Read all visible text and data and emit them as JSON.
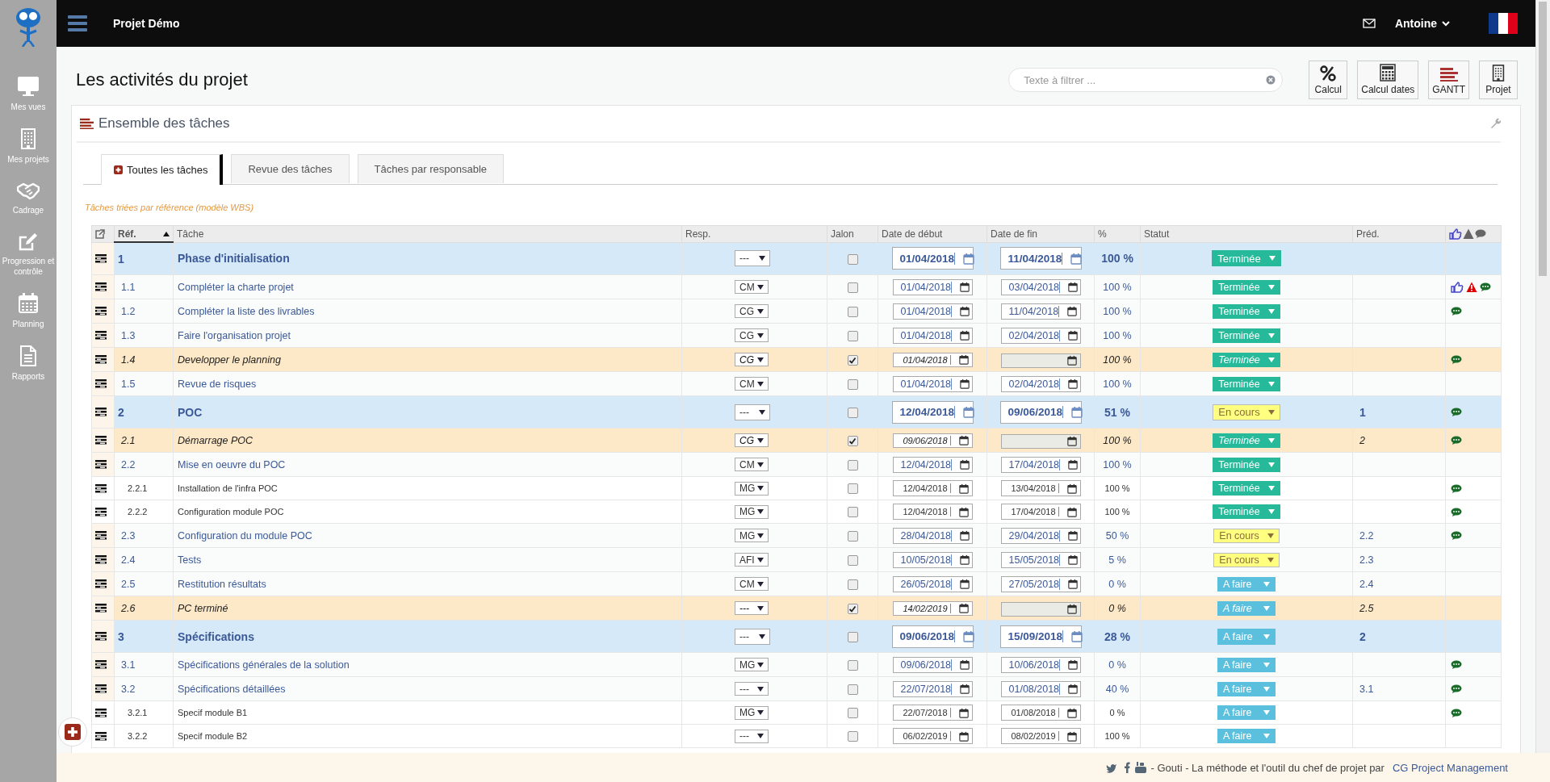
{
  "sidebar": {
    "items": [
      {
        "label": "Mes vues"
      },
      {
        "label": "Mes projets"
      },
      {
        "label": "Cadrage"
      },
      {
        "label": "Progression et contrôle"
      },
      {
        "label": "Planning"
      },
      {
        "label": "Rapports"
      }
    ]
  },
  "topbar": {
    "project": "Projet Démo",
    "user": "Antoine"
  },
  "page": {
    "title": "Les activités du projet",
    "search": {
      "placeholder": "Texte à filtrer ..."
    },
    "buttons": [
      {
        "label": "Calcul"
      },
      {
        "label": "Calcul dates"
      },
      {
        "label": "GANTT"
      },
      {
        "label": "Projet"
      }
    ]
  },
  "panel": {
    "title": "Ensemble des tâches",
    "tabs": [
      {
        "label": "Toutes les tâches",
        "selected": true
      },
      {
        "label": "Revue des tâches",
        "selected": false
      },
      {
        "label": "Tâches par responsable",
        "selected": false
      }
    ],
    "caption": "Tâches triées par référence (modèle WBS)",
    "table": {
      "columns": [
        {
          "label": "Réf.",
          "sorted": true
        },
        {
          "label": "Tâche",
          "sorted": false
        },
        {
          "label": "Resp.",
          "sorted": false
        },
        {
          "label": "Jalon",
          "sorted": false
        },
        {
          "label": "Date de début",
          "sorted": false
        },
        {
          "label": "Date de fin",
          "sorted": false
        },
        {
          "label": "%",
          "sorted": false
        },
        {
          "label": "Statut",
          "sorted": false
        },
        {
          "label": "Préd.",
          "sorted": false
        }
      ],
      "rows": [
        {
          "kind": "phase",
          "ref": "1",
          "task": "Phase d'initialisation",
          "resp": "---",
          "milestone": false,
          "start": "01/04/2018",
          "end": "11/04/2018",
          "pct": "100 %",
          "status": {
            "label": "Terminée",
            "kind": "done"
          },
          "liked": false,
          "alert": false,
          "commented": false
        },
        {
          "kind": "task",
          "ref": "1.1",
          "task": "Compléter la charte projet",
          "resp": "CM",
          "milestone": false,
          "start": "01/04/2018",
          "end": "03/04/2018",
          "pct": "100 %",
          "status": {
            "label": "Terminée",
            "kind": "done"
          },
          "liked": true,
          "alert": true,
          "commented": true
        },
        {
          "kind": "task",
          "ref": "1.2",
          "task": "Compléter la liste des livrables",
          "resp": "CG",
          "milestone": false,
          "start": "01/04/2018",
          "end": "11/04/2018",
          "pct": "100 %",
          "status": {
            "label": "Terminée",
            "kind": "done"
          },
          "liked": false,
          "alert": false,
          "commented": true
        },
        {
          "kind": "task",
          "ref": "1.3",
          "task": "Faire l'organisation projet",
          "resp": "CG",
          "milestone": false,
          "start": "01/04/2018",
          "end": "02/04/2018",
          "pct": "100 %",
          "status": {
            "label": "Terminée",
            "kind": "done"
          },
          "liked": false,
          "alert": false,
          "commented": false
        },
        {
          "kind": "milestone",
          "ref": "1.4",
          "task": "Developper le planning",
          "resp": "CG",
          "milestone": true,
          "start": "01/04/2018",
          "pct": "100 %",
          "status": {
            "label": "Terminée",
            "kind": "done"
          },
          "liked": false,
          "alert": false,
          "commented": true
        },
        {
          "kind": "task",
          "ref": "1.5",
          "task": "Revue de risques",
          "resp": "CM",
          "milestone": false,
          "start": "01/04/2018",
          "end": "02/04/2018",
          "pct": "100 %",
          "status": {
            "label": "Terminée",
            "kind": "done"
          },
          "liked": false,
          "alert": false,
          "commented": false
        },
        {
          "kind": "phase",
          "ref": "2",
          "task": "POC",
          "resp": "---",
          "milestone": false,
          "start": "12/04/2018",
          "end": "09/06/2018",
          "pct": "51 %",
          "status": {
            "label": "En cours",
            "kind": "progress"
          },
          "pred": "1",
          "liked": false,
          "alert": false,
          "commented": true
        },
        {
          "kind": "milestone",
          "ref": "2.1",
          "task": "Démarrage POC",
          "resp": "CG",
          "milestone": true,
          "start": "09/06/2018",
          "pct": "100 %",
          "status": {
            "label": "Terminée",
            "kind": "done"
          },
          "pred": "2",
          "liked": false,
          "alert": false,
          "commented": true
        },
        {
          "kind": "task",
          "ref": "2.2",
          "task": "Mise en oeuvre du POC",
          "resp": "CM",
          "milestone": false,
          "start": "12/04/2018",
          "end": "17/04/2018",
          "pct": "100 %",
          "status": {
            "label": "Terminée",
            "kind": "done"
          },
          "liked": false,
          "alert": false,
          "commented": false
        },
        {
          "kind": "subtask",
          "ref": "2.2.1",
          "task": "Installation de l'infra POC",
          "resp": "MG",
          "milestone": false,
          "start": "12/04/2018",
          "end": "13/04/2018",
          "pct": "100 %",
          "status": {
            "label": "Terminée",
            "kind": "done"
          },
          "liked": false,
          "alert": false,
          "commented": true
        },
        {
          "kind": "subtask",
          "ref": "2.2.2",
          "task": "Configuration module POC",
          "resp": "MG",
          "milestone": false,
          "start": "12/04/2018",
          "end": "17/04/2018",
          "pct": "100 %",
          "status": {
            "label": "Terminée",
            "kind": "done"
          },
          "liked": false,
          "alert": false,
          "commented": true
        },
        {
          "kind": "task",
          "ref": "2.3",
          "task": "Configuration du module POC",
          "resp": "MG",
          "milestone": false,
          "start": "28/04/2018",
          "end": "29/04/2018",
          "pct": "50 %",
          "status": {
            "label": "En cours",
            "kind": "progress"
          },
          "pred": "2.2",
          "liked": false,
          "alert": false,
          "commented": true
        },
        {
          "kind": "task",
          "ref": "2.4",
          "task": "Tests",
          "resp": "AFI",
          "milestone": false,
          "start": "10/05/2018",
          "end": "15/05/2018",
          "pct": "5 %",
          "status": {
            "label": "En cours",
            "kind": "progress"
          },
          "pred": "2.3",
          "liked": false,
          "alert": false,
          "commented": false
        },
        {
          "kind": "task",
          "ref": "2.5",
          "task": "Restitution résultats",
          "resp": "CM",
          "milestone": false,
          "start": "26/05/2018",
          "end": "27/05/2018",
          "pct": "0 %",
          "status": {
            "label": "A faire",
            "kind": "todo"
          },
          "pred": "2.4",
          "liked": false,
          "alert": false,
          "commented": false
        },
        {
          "kind": "milestone",
          "ref": "2.6",
          "task": "PC terminé",
          "resp": "---",
          "milestone": true,
          "start": "14/02/2019",
          "pct": "0 %",
          "status": {
            "label": "A faire",
            "kind": "todo"
          },
          "pred": "2.5",
          "liked": false,
          "alert": false,
          "commented": false
        },
        {
          "kind": "phase",
          "ref": "3",
          "task": "Spécifications",
          "resp": "---",
          "milestone": false,
          "start": "09/06/2018",
          "end": "15/09/2018",
          "pct": "28 %",
          "status": {
            "label": "A faire",
            "kind": "todo"
          },
          "pred": "2",
          "liked": false,
          "alert": false,
          "commented": false
        },
        {
          "kind": "task",
          "ref": "3.1",
          "task": "Spécifications générales de la solution",
          "resp": "MG",
          "milestone": false,
          "start": "09/06/2018",
          "end": "10/06/2018",
          "pct": "0 %",
          "status": {
            "label": "A faire",
            "kind": "todo"
          },
          "liked": false,
          "alert": false,
          "commented": true
        },
        {
          "kind": "task",
          "ref": "3.2",
          "task": "Spécifications détaillées",
          "resp": "---",
          "milestone": false,
          "start": "22/07/2018",
          "end": "01/08/2018",
          "pct": "40 %",
          "status": {
            "label": "A faire",
            "kind": "todo"
          },
          "pred": "3.1",
          "liked": false,
          "alert": false,
          "commented": true
        },
        {
          "kind": "subtask",
          "ref": "3.2.1",
          "task": "Specif module B1",
          "resp": "MG",
          "milestone": false,
          "start": "22/07/2018",
          "end": "01/08/2018",
          "pct": "0 %",
          "status": {
            "label": "A faire",
            "kind": "todo"
          },
          "liked": false,
          "alert": false,
          "commented": true
        },
        {
          "kind": "subtask",
          "ref": "3.2.2",
          "task": "Specif module B2",
          "resp": "---",
          "milestone": false,
          "start": "06/02/2019",
          "end": "08/02/2019",
          "pct": "100 %",
          "status": {
            "label": "A faire",
            "kind": "todo"
          },
          "liked": false,
          "alert": false,
          "commented": false
        }
      ]
    }
  },
  "footer": {
    "text": "- Gouti - La méthode et l'outil du chef de projet par",
    "link": "CG Project Management"
  }
}
